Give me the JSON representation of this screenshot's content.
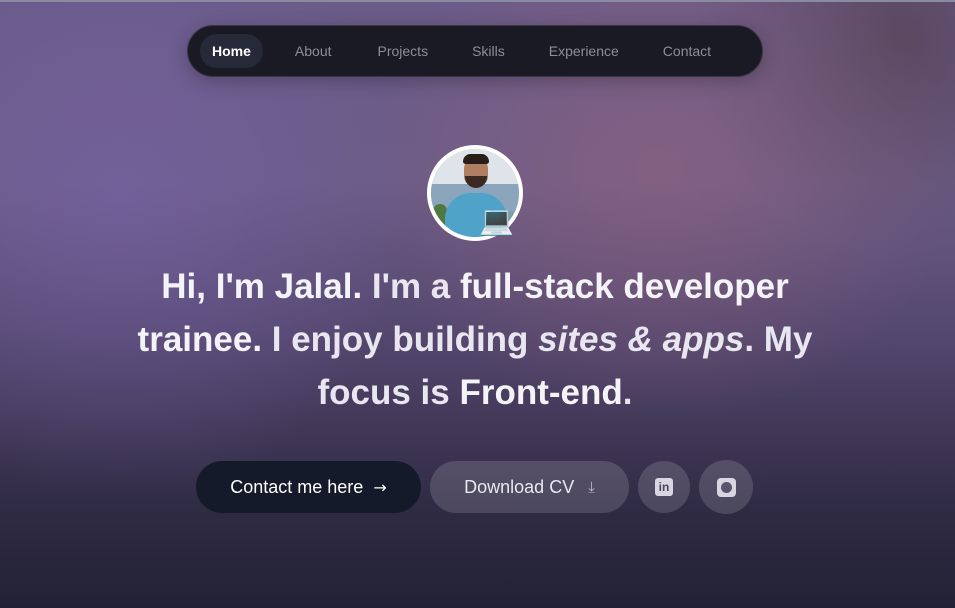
{
  "nav": {
    "items": [
      {
        "label": "Home",
        "active": true
      },
      {
        "label": "About",
        "active": false
      },
      {
        "label": "Projects",
        "active": false
      },
      {
        "label": "Skills",
        "active": false
      },
      {
        "label": "Experience",
        "active": false
      },
      {
        "label": "Contact",
        "active": false
      }
    ]
  },
  "hero": {
    "avatar_icon": "profile-photo",
    "avatar_badge": "💻",
    "headline": {
      "greeting_bold": "Hi, I'm Jalal.",
      "part1": " I'm a ",
      "role_bold": "full-stack developer trainee.",
      "part2": " I enjoy building ",
      "focus_italic": "sites & apps",
      "part3": ". My focus is ",
      "specialty_bold": "Front-end",
      "part4": "."
    }
  },
  "actions": {
    "contact_label": "Contact me here",
    "contact_icon": "→",
    "cv_label": "Download CV",
    "cv_icon": "⤓",
    "linkedin_icon": "in",
    "github_icon": "github-icon"
  },
  "colors": {
    "nav_bg": "#1a1a24",
    "contact_button_bg": "#151a2a",
    "avatar_border": "#ffffff"
  }
}
